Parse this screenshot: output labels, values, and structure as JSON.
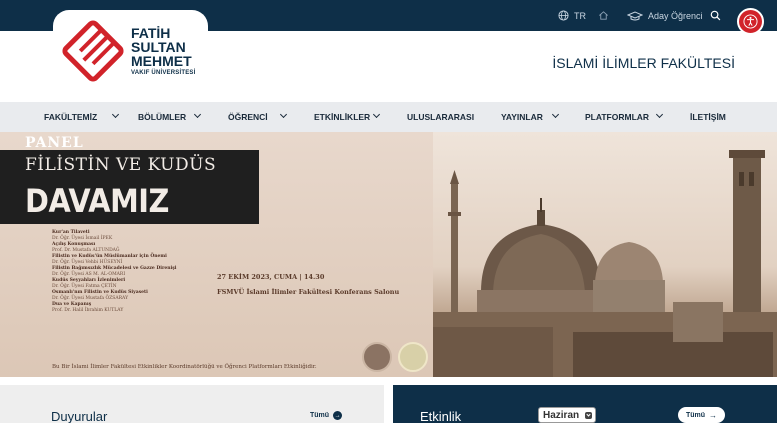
{
  "topbar": {
    "lang": "TR",
    "aday": "Aday Öğrenci"
  },
  "logo": {
    "line1": "FATİH",
    "line2": "SULTAN",
    "line3": "MEHMET",
    "line4": "VAKIF ÜNİVERSİTESİ"
  },
  "header": {
    "faculty": "İSLAMİ İLİMLER FAKÜLTESİ"
  },
  "nav": {
    "items": [
      {
        "label": "FAKÜLTEMİZ"
      },
      {
        "label": "BÖLÜMLER"
      },
      {
        "label": "ÖĞRENCİ"
      },
      {
        "label": "ETKİNLİKLER"
      },
      {
        "label": "ULUSLARARASI"
      },
      {
        "label": "YAYINLAR"
      },
      {
        "label": "PLATFORMLAR"
      },
      {
        "label": "İLETİŞİM"
      }
    ]
  },
  "banner": {
    "panel": "PANEL",
    "title1": "FİLİSTİN VE KUDÜS",
    "title2": "DAVAMIZ",
    "program": [
      {
        "role": "Kur'an Tilaveti",
        "name": "Dr. Öğr. Üyesi İsmail İPEK"
      },
      {
        "role": "Açılış Konuşması",
        "name": "Prof. Dr. Mustafa ALTUNDAĞ"
      },
      {
        "role": "Filistin ve Kudüs'ün Müslümanlar için Önemi",
        "name": "Dr. Öğr. Üyesi Vehbi HÜSEYNİ"
      },
      {
        "role": "Filistin Bağımsızlık Mücadelesi ve Gazze Direnişi",
        "name": "Dr. Öğr. Üyesi AS M. AL-OMARI"
      },
      {
        "role": "Kudüs Seyyahları İzlenimleri",
        "name": "Dr. Öğr. Üyesi Fatma ÇETİN"
      },
      {
        "role": "Osmanlı'nın Filistin ve Kudüs Siyaseti",
        "name": "Dr. Öğr. Üyesi Mustafa ÖZSARAY"
      },
      {
        "role": "Dua ve Kapanış",
        "name": "Prof. Dr. Halil İbrahim KUTLAY"
      }
    ],
    "date": "27 EKİM 2023, CUMA | 14.30",
    "venue": "FSMVÜ İslami İlimler Fakültesi Konferans Salonu",
    "footer": "Bu Bir İslami İlimler Fakültesi Etkinlikler Koordinatörlüğü ve Öğrenci Platformları Etkinliğidir."
  },
  "duyurular": {
    "title": "Duyurular",
    "more": "Tümü"
  },
  "etkinlik": {
    "title": "Etkinlik",
    "month": "Haziran",
    "more": "Tümü"
  },
  "colors": {
    "navy": "#0e2f48",
    "red": "#d1232a",
    "nav_bg": "#e9ebee"
  }
}
